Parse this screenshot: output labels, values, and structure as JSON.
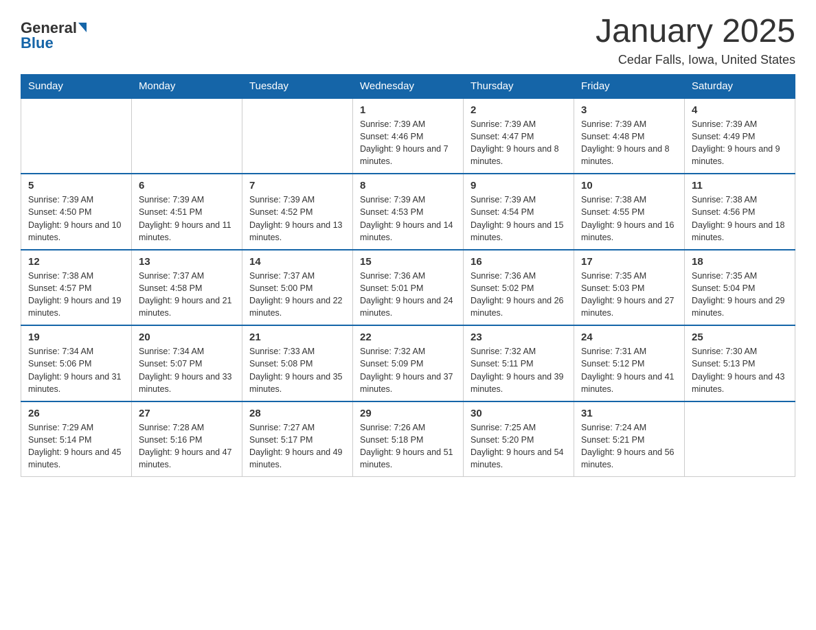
{
  "logo": {
    "general": "General",
    "blue": "Blue"
  },
  "title": "January 2025",
  "location": "Cedar Falls, Iowa, United States",
  "days_of_week": [
    "Sunday",
    "Monday",
    "Tuesday",
    "Wednesday",
    "Thursday",
    "Friday",
    "Saturday"
  ],
  "weeks": [
    [
      {
        "day": "",
        "info": ""
      },
      {
        "day": "",
        "info": ""
      },
      {
        "day": "",
        "info": ""
      },
      {
        "day": "1",
        "info": "Sunrise: 7:39 AM\nSunset: 4:46 PM\nDaylight: 9 hours and 7 minutes."
      },
      {
        "day": "2",
        "info": "Sunrise: 7:39 AM\nSunset: 4:47 PM\nDaylight: 9 hours and 8 minutes."
      },
      {
        "day": "3",
        "info": "Sunrise: 7:39 AM\nSunset: 4:48 PM\nDaylight: 9 hours and 8 minutes."
      },
      {
        "day": "4",
        "info": "Sunrise: 7:39 AM\nSunset: 4:49 PM\nDaylight: 9 hours and 9 minutes."
      }
    ],
    [
      {
        "day": "5",
        "info": "Sunrise: 7:39 AM\nSunset: 4:50 PM\nDaylight: 9 hours and 10 minutes."
      },
      {
        "day": "6",
        "info": "Sunrise: 7:39 AM\nSunset: 4:51 PM\nDaylight: 9 hours and 11 minutes."
      },
      {
        "day": "7",
        "info": "Sunrise: 7:39 AM\nSunset: 4:52 PM\nDaylight: 9 hours and 13 minutes."
      },
      {
        "day": "8",
        "info": "Sunrise: 7:39 AM\nSunset: 4:53 PM\nDaylight: 9 hours and 14 minutes."
      },
      {
        "day": "9",
        "info": "Sunrise: 7:39 AM\nSunset: 4:54 PM\nDaylight: 9 hours and 15 minutes."
      },
      {
        "day": "10",
        "info": "Sunrise: 7:38 AM\nSunset: 4:55 PM\nDaylight: 9 hours and 16 minutes."
      },
      {
        "day": "11",
        "info": "Sunrise: 7:38 AM\nSunset: 4:56 PM\nDaylight: 9 hours and 18 minutes."
      }
    ],
    [
      {
        "day": "12",
        "info": "Sunrise: 7:38 AM\nSunset: 4:57 PM\nDaylight: 9 hours and 19 minutes."
      },
      {
        "day": "13",
        "info": "Sunrise: 7:37 AM\nSunset: 4:58 PM\nDaylight: 9 hours and 21 minutes."
      },
      {
        "day": "14",
        "info": "Sunrise: 7:37 AM\nSunset: 5:00 PM\nDaylight: 9 hours and 22 minutes."
      },
      {
        "day": "15",
        "info": "Sunrise: 7:36 AM\nSunset: 5:01 PM\nDaylight: 9 hours and 24 minutes."
      },
      {
        "day": "16",
        "info": "Sunrise: 7:36 AM\nSunset: 5:02 PM\nDaylight: 9 hours and 26 minutes."
      },
      {
        "day": "17",
        "info": "Sunrise: 7:35 AM\nSunset: 5:03 PM\nDaylight: 9 hours and 27 minutes."
      },
      {
        "day": "18",
        "info": "Sunrise: 7:35 AM\nSunset: 5:04 PM\nDaylight: 9 hours and 29 minutes."
      }
    ],
    [
      {
        "day": "19",
        "info": "Sunrise: 7:34 AM\nSunset: 5:06 PM\nDaylight: 9 hours and 31 minutes."
      },
      {
        "day": "20",
        "info": "Sunrise: 7:34 AM\nSunset: 5:07 PM\nDaylight: 9 hours and 33 minutes."
      },
      {
        "day": "21",
        "info": "Sunrise: 7:33 AM\nSunset: 5:08 PM\nDaylight: 9 hours and 35 minutes."
      },
      {
        "day": "22",
        "info": "Sunrise: 7:32 AM\nSunset: 5:09 PM\nDaylight: 9 hours and 37 minutes."
      },
      {
        "day": "23",
        "info": "Sunrise: 7:32 AM\nSunset: 5:11 PM\nDaylight: 9 hours and 39 minutes."
      },
      {
        "day": "24",
        "info": "Sunrise: 7:31 AM\nSunset: 5:12 PM\nDaylight: 9 hours and 41 minutes."
      },
      {
        "day": "25",
        "info": "Sunrise: 7:30 AM\nSunset: 5:13 PM\nDaylight: 9 hours and 43 minutes."
      }
    ],
    [
      {
        "day": "26",
        "info": "Sunrise: 7:29 AM\nSunset: 5:14 PM\nDaylight: 9 hours and 45 minutes."
      },
      {
        "day": "27",
        "info": "Sunrise: 7:28 AM\nSunset: 5:16 PM\nDaylight: 9 hours and 47 minutes."
      },
      {
        "day": "28",
        "info": "Sunrise: 7:27 AM\nSunset: 5:17 PM\nDaylight: 9 hours and 49 minutes."
      },
      {
        "day": "29",
        "info": "Sunrise: 7:26 AM\nSunset: 5:18 PM\nDaylight: 9 hours and 51 minutes."
      },
      {
        "day": "30",
        "info": "Sunrise: 7:25 AM\nSunset: 5:20 PM\nDaylight: 9 hours and 54 minutes."
      },
      {
        "day": "31",
        "info": "Sunrise: 7:24 AM\nSunset: 5:21 PM\nDaylight: 9 hours and 56 minutes."
      },
      {
        "day": "",
        "info": ""
      }
    ]
  ]
}
